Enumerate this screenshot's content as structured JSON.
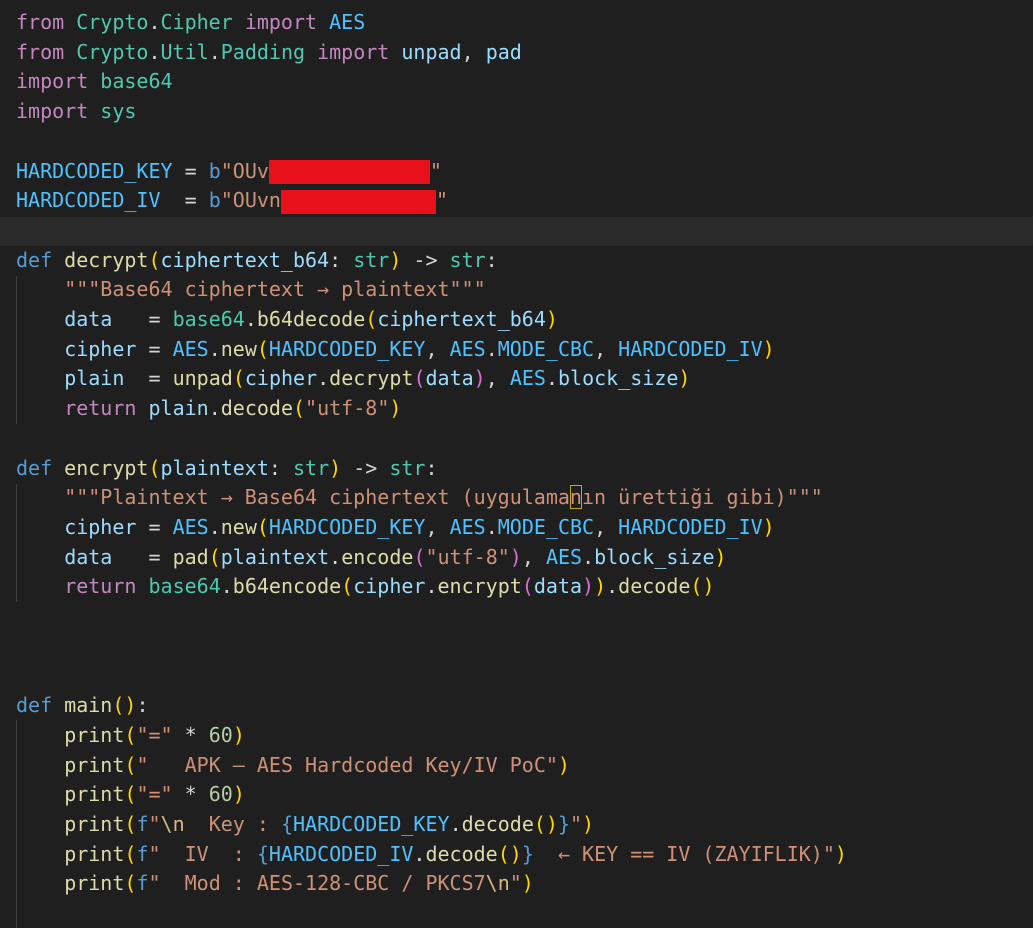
{
  "code_lines": [
    "from Crypto.Cipher import AES",
    "from Crypto.Util.Padding import unpad, pad",
    "import base64",
    "import sys",
    "",
    "HARDCODED_KEY = b\"OUv\"",
    "HARDCODED_IV  = b\"OUvn\"",
    "",
    "def decrypt(ciphertext_b64: str) -> str:",
    "    \"\"\"Base64 ciphertext → plaintext\"\"\"",
    "    data   = base64.b64decode(ciphertext_b64)",
    "    cipher = AES.new(HARDCODED_KEY, AES.MODE_CBC, HARDCODED_IV)",
    "    plain  = unpad(cipher.decrypt(data), AES.block_size)",
    "    return plain.decode(\"utf-8\")",
    "",
    "def encrypt(plaintext: str) -> str:",
    "    \"\"\"Plaintext → Base64 ciphertext (uygulamanın ürettiği gibi)\"\"\"",
    "    cipher = AES.new(HARDCODED_KEY, AES.MODE_CBC, HARDCODED_IV)",
    "    data   = pad(plaintext.encode(\"utf-8\"), AES.block_size)",
    "    return base64.b64encode(cipher.encrypt(data)).decode()",
    "",
    "",
    "",
    "def main():",
    "    print(\"=\" * 60)",
    "    print(\"   APK — AES Hardcoded Key/IV PoC\")",
    "    print(\"=\" * 60)",
    "    print(f\"\\n  Key : {HARDCODED_KEY.decode()}\")",
    "    print(f\"  IV  : {HARDCODED_IV.decode()}  ← KEY == IV (ZAYIFLIK)\")",
    "    print(f\"  Mod : AES-128-CBC / PKCS7\\n\")"
  ],
  "syntax_colors": {
    "background": "#1f1f1f",
    "keyword": "#c586c0",
    "storage_def": "#569cd6",
    "function": "#dcdcaa",
    "constant": "#4fc1ff",
    "variable": "#9cdcfe",
    "type": "#4ec9b0",
    "string": "#ce9178",
    "number": "#b5cea8",
    "redaction": "#e8111b"
  }
}
